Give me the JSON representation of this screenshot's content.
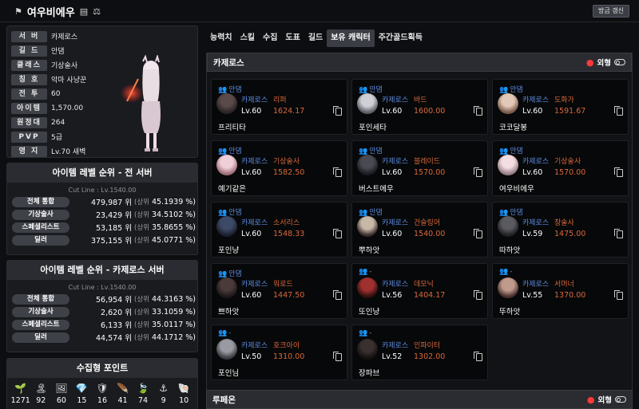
{
  "header": {
    "title": "여우비에우",
    "refresh_label": "방금 갱신"
  },
  "profile": {
    "rows": [
      {
        "label": "서 버",
        "value": "카제로스"
      },
      {
        "label": "길 드",
        "value": "안댐"
      },
      {
        "label": "클래스",
        "value": "기상술사"
      },
      {
        "label": "칭 호",
        "value": "악마 사냥꾼"
      },
      {
        "label": "전 투",
        "value": "60"
      },
      {
        "label": "아이템",
        "value": "1,570.00"
      },
      {
        "label": "원정대",
        "value": "264"
      },
      {
        "label": "PVP",
        "value": "5급"
      },
      {
        "label": "영 지",
        "value": "Lv.70 새벽"
      }
    ]
  },
  "rank_all": {
    "title": "아이템 레벨 순위 - 전 서버",
    "cutline": "Cut Line : Lv.1540.00",
    "rows": [
      {
        "label": "전체 통합",
        "rank": "479,987 위",
        "sang": "(상위",
        "pct": "45.1939 %)"
      },
      {
        "label": "기상술사",
        "rank": "23,429 위",
        "sang": "(상위",
        "pct": "34.5102 %)"
      },
      {
        "label": "스페셜리스트",
        "rank": "53,185 위",
        "sang": "(상위",
        "pct": "35.8655 %)"
      },
      {
        "label": "딜러",
        "rank": "375,155 위",
        "sang": "(상위",
        "pct": "45.0771 %)"
      }
    ]
  },
  "rank_server": {
    "title": "아이템 레벨 순위 - 카제로스 서버",
    "cutline": "Cut Line : Lv.1540.00",
    "rows": [
      {
        "label": "전체 통합",
        "rank": "56,954 위",
        "sang": "(상위",
        "pct": "44.3163 %)"
      },
      {
        "label": "기상술사",
        "rank": "2,620 위",
        "sang": "(상위",
        "pct": "33.1059 %)"
      },
      {
        "label": "스페셜리스트",
        "rank": "6,133 위",
        "sang": "(상위",
        "pct": "35.0117 %)"
      },
      {
        "label": "딜러",
        "rank": "44,574 위",
        "sang": "(상위",
        "pct": "44.1712 %)"
      }
    ]
  },
  "collection": {
    "title": "수집형 포인트",
    "items": [
      {
        "icon": "seed-icon",
        "glyph": "🌱",
        "value": "1271"
      },
      {
        "icon": "island-heart-icon",
        "glyph": "🏝",
        "value": "92"
      },
      {
        "icon": "art-icon",
        "glyph": "🖼",
        "value": "60"
      },
      {
        "icon": "giant-heart-icon",
        "glyph": "💎",
        "value": "15"
      },
      {
        "icon": "ignea-token-icon",
        "glyph": "🛡",
        "value": "16"
      },
      {
        "icon": "orpheus-star-icon",
        "glyph": "🪶",
        "value": "41"
      },
      {
        "icon": "world-tree-leaf-icon",
        "glyph": "🍃",
        "value": "74"
      },
      {
        "icon": "voyage-icon",
        "glyph": "⚓",
        "value": "9"
      },
      {
        "icon": "sea-bounty-icon",
        "glyph": "🐚",
        "value": "10"
      }
    ]
  },
  "tabs": [
    "능력치",
    "스킬",
    "수집",
    "도표",
    "길드",
    "보유 캐릭터",
    "주간골드획득"
  ],
  "active_tab": 5,
  "server1": {
    "name": "카제로스",
    "toggle_label": "외형"
  },
  "server2": {
    "name": "루페온",
    "toggle_label": "외형"
  },
  "characters": [
    {
      "guild": "안댐",
      "server": "카제로스",
      "class": "리퍼",
      "level": "Lv.60",
      "ilvl": "1624.17",
      "name": "프리티타"
    },
    {
      "guild": "안댐",
      "server": "카제로스",
      "class": "바드",
      "level": "Lv.60",
      "ilvl": "1600.00",
      "name": "포인세타"
    },
    {
      "guild": "안댐",
      "server": "카제로스",
      "class": "도화가",
      "level": "Lv.60",
      "ilvl": "1591.67",
      "name": "코코달봉"
    },
    {
      "guild": "안댐",
      "server": "카제로스",
      "class": "기상술사",
      "level": "Lv.60",
      "ilvl": "1582.50",
      "name": "예기같은"
    },
    {
      "guild": "안댐",
      "server": "카제로스",
      "class": "블레이드",
      "level": "Lv.60",
      "ilvl": "1570.00",
      "name": "버스트에우"
    },
    {
      "guild": "안댐",
      "server": "카제로스",
      "class": "기상술사",
      "level": "Lv.60",
      "ilvl": "1570.00",
      "name": "여우비에우"
    },
    {
      "guild": "안댐",
      "server": "카제로스",
      "class": "소서리스",
      "level": "Lv.60",
      "ilvl": "1548.33",
      "name": "포인냥"
    },
    {
      "guild": "안댐",
      "server": "카제로스",
      "class": "건슬링어",
      "level": "Lv.60",
      "ilvl": "1540.00",
      "name": "뿌하앗"
    },
    {
      "guild": "안댐",
      "server": "카제로스",
      "class": "창술사",
      "level": "Lv.59",
      "ilvl": "1475.00",
      "name": "따하앗"
    },
    {
      "guild": "안댐",
      "server": "카제로스",
      "class": "워로드",
      "level": "Lv.60",
      "ilvl": "1447.50",
      "name": "쁘하앗"
    },
    {
      "guild": "-",
      "server": "카제로스",
      "class": "데모닉",
      "level": "Lv.56",
      "ilvl": "1404.17",
      "name": "또인냥"
    },
    {
      "guild": "-",
      "server": "카제로스",
      "class": "서머너",
      "level": "Lv.55",
      "ilvl": "1370.00",
      "name": "뚜하앗"
    },
    {
      "guild": "-",
      "server": "카제로스",
      "class": "호크아이",
      "level": "Lv.50",
      "ilvl": "1310.00",
      "name": "포인님"
    },
    {
      "guild": "-",
      "server": "카제로스",
      "class": "인파이터",
      "level": "Lv.52",
      "ilvl": "1302.00",
      "name": "장파브"
    }
  ]
}
